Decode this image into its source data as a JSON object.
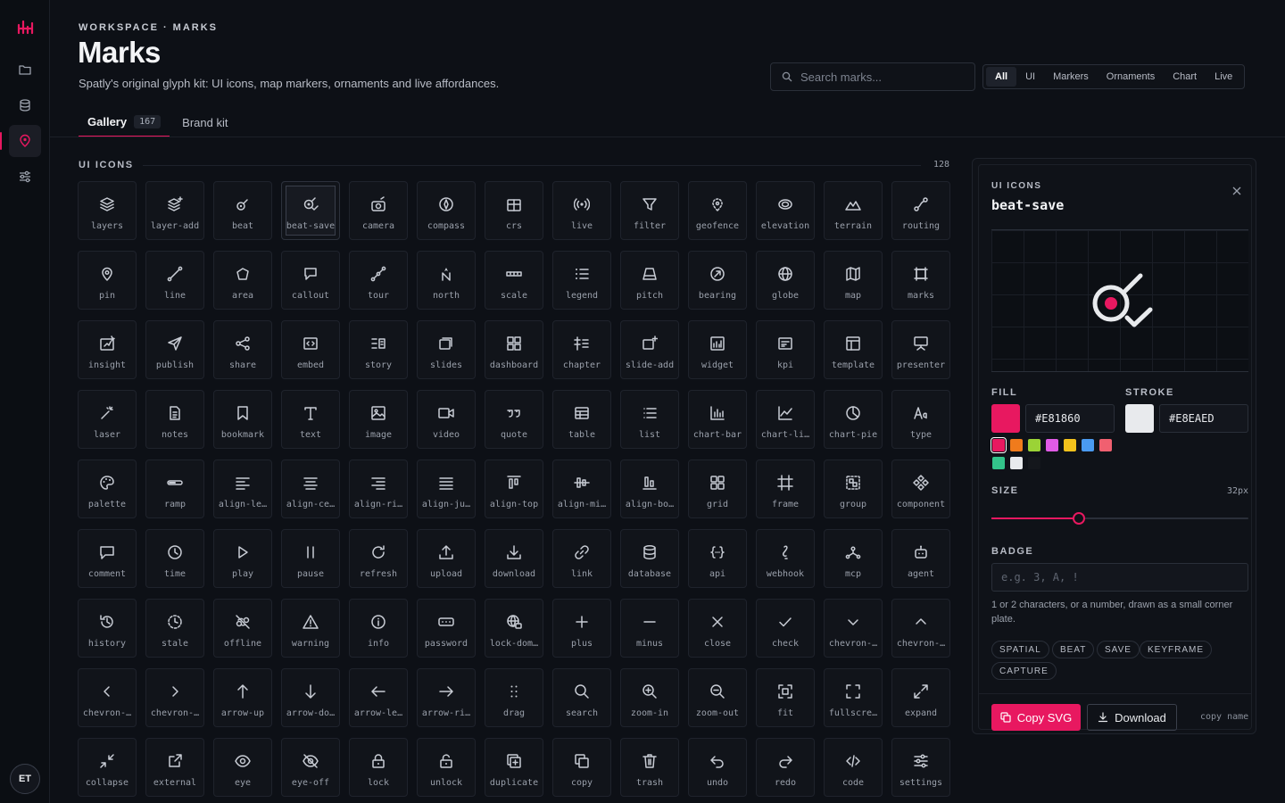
{
  "app": {
    "avatar_initials": "ET",
    "accent": "#E81860"
  },
  "rail": {
    "items": [
      "folder-icon",
      "database-icon",
      "pin-icon",
      "settings-icon"
    ]
  },
  "header": {
    "breadcrumb": "WORKSPACE · MARKS",
    "title": "Marks",
    "subtitle": "Spatly's original glyph kit: UI icons, map markers, ornaments and live affordances."
  },
  "search": {
    "placeholder": "Search marks..."
  },
  "filters": [
    "All",
    "UI",
    "Markers",
    "Ornaments",
    "Chart",
    "Live"
  ],
  "filters_active": "All",
  "tabs": [
    {
      "label": "Gallery",
      "count": "167"
    },
    {
      "label": "Brand kit"
    }
  ],
  "section": {
    "label": "UI ICONS",
    "count": "128"
  },
  "icons": [
    "layers",
    "layer-add",
    "beat",
    "beat-save",
    "camera",
    "compass",
    "crs",
    "live",
    "filter",
    "geofence",
    "elevation",
    "terrain",
    "routing",
    "pin",
    "line",
    "area",
    "callout",
    "tour",
    "north",
    "scale",
    "legend",
    "pitch",
    "bearing",
    "globe",
    "map",
    "marks",
    "insight",
    "publish",
    "share",
    "embed",
    "story",
    "slides",
    "dashboard",
    "chapter",
    "slide-add",
    "widget",
    "kpi",
    "template",
    "presenter",
    "laser",
    "notes",
    "bookmark",
    "text",
    "image",
    "video",
    "quote",
    "table",
    "list",
    "chart-bar",
    "chart-li…",
    "chart-pie",
    "type",
    "palette",
    "ramp",
    "align-le…",
    "align-ce…",
    "align-ri…",
    "align-ju…",
    "align-top",
    "align-mi…",
    "align-bo…",
    "grid",
    "frame",
    "group",
    "component",
    "comment",
    "time",
    "play",
    "pause",
    "refresh",
    "upload",
    "download",
    "link",
    "database",
    "api",
    "webhook",
    "mcp",
    "agent",
    "history",
    "stale",
    "offline",
    "warning",
    "info",
    "password",
    "lock-dom…",
    "plus",
    "minus",
    "close",
    "check",
    "chevron-…",
    "chevron-…",
    "chevron-…",
    "chevron-…",
    "arrow-up",
    "arrow-do…",
    "arrow-le…",
    "arrow-ri…",
    "drag",
    "search",
    "zoom-in",
    "zoom-out",
    "fit",
    "fullscre…",
    "expand",
    "collapse",
    "external",
    "eye",
    "eye-off",
    "lock",
    "unlock",
    "duplicate",
    "copy",
    "trash",
    "undo",
    "redo",
    "code",
    "settings"
  ],
  "selected_icon": "beat-save",
  "detail": {
    "category": "UI ICONS",
    "name": "beat-save",
    "fill_label": "FILL",
    "stroke_label": "STROKE",
    "fill": "#E81860",
    "stroke": "#E8EAED",
    "palette": [
      "#E81860",
      "#F07B1C",
      "#9BD336",
      "#E15BE6",
      "#F3C21C",
      "#4A9AF0",
      "#F06070",
      "#33C38A",
      "#E8EAED",
      "#14171C"
    ],
    "size_label": "SIZE",
    "size_value": "32px",
    "size_fraction": 0.34,
    "badge_label": "BADGE",
    "badge_placeholder": "e.g. 3, A, !",
    "badge_hint": "1 or 2 characters, or a number, drawn as a small corner plate.",
    "tags": [
      "SPATIAL",
      "BEAT",
      "SAVE",
      "KEYFRAME",
      "CAPTURE"
    ],
    "copy_svg": "Copy SVG",
    "download": "Download",
    "copy_name": "copy name"
  }
}
